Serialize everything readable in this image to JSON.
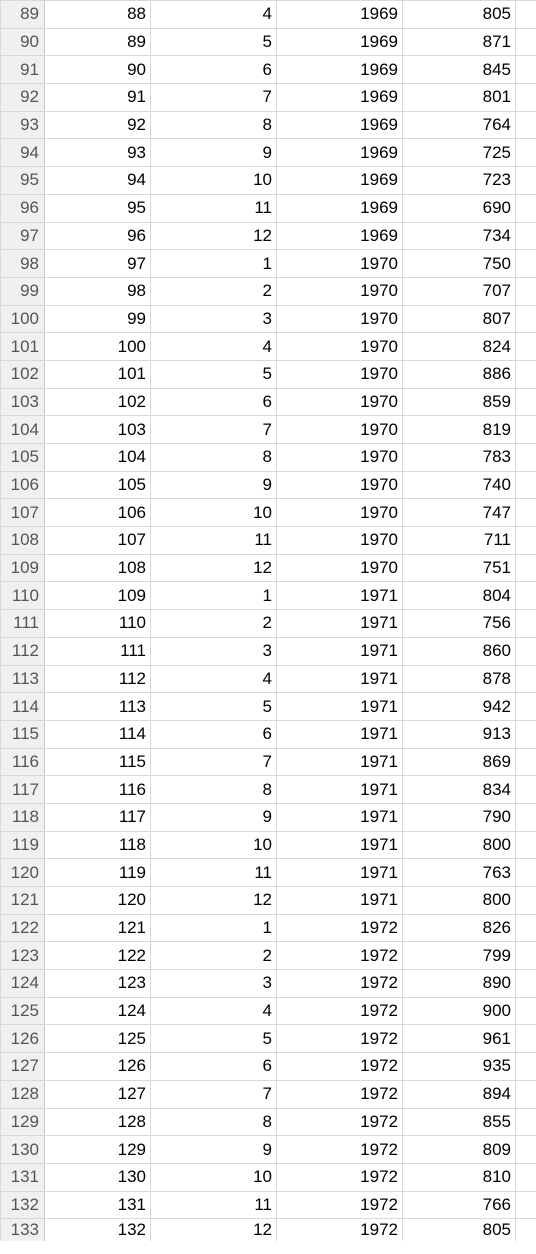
{
  "rows": [
    {
      "n": 89,
      "c1": 88,
      "c2": 4,
      "c3": 1969,
      "c4": 805
    },
    {
      "n": 90,
      "c1": 89,
      "c2": 5,
      "c3": 1969,
      "c4": 871
    },
    {
      "n": 91,
      "c1": 90,
      "c2": 6,
      "c3": 1969,
      "c4": 845
    },
    {
      "n": 92,
      "c1": 91,
      "c2": 7,
      "c3": 1969,
      "c4": 801
    },
    {
      "n": 93,
      "c1": 92,
      "c2": 8,
      "c3": 1969,
      "c4": 764
    },
    {
      "n": 94,
      "c1": 93,
      "c2": 9,
      "c3": 1969,
      "c4": 725
    },
    {
      "n": 95,
      "c1": 94,
      "c2": 10,
      "c3": 1969,
      "c4": 723
    },
    {
      "n": 96,
      "c1": 95,
      "c2": 11,
      "c3": 1969,
      "c4": 690
    },
    {
      "n": 97,
      "c1": 96,
      "c2": 12,
      "c3": 1969,
      "c4": 734
    },
    {
      "n": 98,
      "c1": 97,
      "c2": 1,
      "c3": 1970,
      "c4": 750
    },
    {
      "n": 99,
      "c1": 98,
      "c2": 2,
      "c3": 1970,
      "c4": 707
    },
    {
      "n": 100,
      "c1": 99,
      "c2": 3,
      "c3": 1970,
      "c4": 807
    },
    {
      "n": 101,
      "c1": 100,
      "c2": 4,
      "c3": 1970,
      "c4": 824
    },
    {
      "n": 102,
      "c1": 101,
      "c2": 5,
      "c3": 1970,
      "c4": 886
    },
    {
      "n": 103,
      "c1": 102,
      "c2": 6,
      "c3": 1970,
      "c4": 859
    },
    {
      "n": 104,
      "c1": 103,
      "c2": 7,
      "c3": 1970,
      "c4": 819
    },
    {
      "n": 105,
      "c1": 104,
      "c2": 8,
      "c3": 1970,
      "c4": 783
    },
    {
      "n": 106,
      "c1": 105,
      "c2": 9,
      "c3": 1970,
      "c4": 740
    },
    {
      "n": 107,
      "c1": 106,
      "c2": 10,
      "c3": 1970,
      "c4": 747
    },
    {
      "n": 108,
      "c1": 107,
      "c2": 11,
      "c3": 1970,
      "c4": 711
    },
    {
      "n": 109,
      "c1": 108,
      "c2": 12,
      "c3": 1970,
      "c4": 751
    },
    {
      "n": 110,
      "c1": 109,
      "c2": 1,
      "c3": 1971,
      "c4": 804
    },
    {
      "n": 111,
      "c1": 110,
      "c2": 2,
      "c3": 1971,
      "c4": 756
    },
    {
      "n": 112,
      "c1": 111,
      "c2": 3,
      "c3": 1971,
      "c4": 860
    },
    {
      "n": 113,
      "c1": 112,
      "c2": 4,
      "c3": 1971,
      "c4": 878
    },
    {
      "n": 114,
      "c1": 113,
      "c2": 5,
      "c3": 1971,
      "c4": 942
    },
    {
      "n": 115,
      "c1": 114,
      "c2": 6,
      "c3": 1971,
      "c4": 913
    },
    {
      "n": 116,
      "c1": 115,
      "c2": 7,
      "c3": 1971,
      "c4": 869
    },
    {
      "n": 117,
      "c1": 116,
      "c2": 8,
      "c3": 1971,
      "c4": 834
    },
    {
      "n": 118,
      "c1": 117,
      "c2": 9,
      "c3": 1971,
      "c4": 790
    },
    {
      "n": 119,
      "c1": 118,
      "c2": 10,
      "c3": 1971,
      "c4": 800
    },
    {
      "n": 120,
      "c1": 119,
      "c2": 11,
      "c3": 1971,
      "c4": 763
    },
    {
      "n": 121,
      "c1": 120,
      "c2": 12,
      "c3": 1971,
      "c4": 800
    },
    {
      "n": 122,
      "c1": 121,
      "c2": 1,
      "c3": 1972,
      "c4": 826
    },
    {
      "n": 123,
      "c1": 122,
      "c2": 2,
      "c3": 1972,
      "c4": 799
    },
    {
      "n": 124,
      "c1": 123,
      "c2": 3,
      "c3": 1972,
      "c4": 890
    },
    {
      "n": 125,
      "c1": 124,
      "c2": 4,
      "c3": 1972,
      "c4": 900
    },
    {
      "n": 126,
      "c1": 125,
      "c2": 5,
      "c3": 1972,
      "c4": 961
    },
    {
      "n": 127,
      "c1": 126,
      "c2": 6,
      "c3": 1972,
      "c4": 935
    },
    {
      "n": 128,
      "c1": 127,
      "c2": 7,
      "c3": 1972,
      "c4": 894
    },
    {
      "n": 129,
      "c1": 128,
      "c2": 8,
      "c3": 1972,
      "c4": 855
    },
    {
      "n": 130,
      "c1": 129,
      "c2": 9,
      "c3": 1972,
      "c4": 809
    },
    {
      "n": 131,
      "c1": 130,
      "c2": 10,
      "c3": 1972,
      "c4": 810
    },
    {
      "n": 132,
      "c1": 131,
      "c2": 11,
      "c3": 1972,
      "c4": 766
    },
    {
      "n": 133,
      "c1": 132,
      "c2": 12,
      "c3": 1972,
      "c4": 805
    }
  ]
}
